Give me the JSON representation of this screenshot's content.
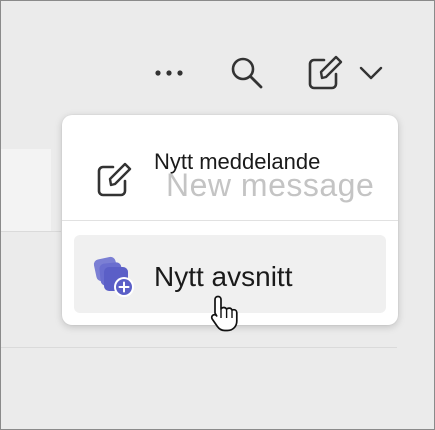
{
  "toolbar": {
    "more_icon": "more-horizontal-icon",
    "search_icon": "search-icon",
    "compose_icon": "compose-icon",
    "compose_dropdown_icon": "chevron-down-icon"
  },
  "menu": {
    "items": [
      {
        "label": "Nytt meddelande",
        "ghost_label": "New message",
        "icon": "compose-icon"
      },
      {
        "label": "Nytt avsnitt",
        "icon": "add-section-icon",
        "accent": "#5b5fc7"
      }
    ]
  }
}
